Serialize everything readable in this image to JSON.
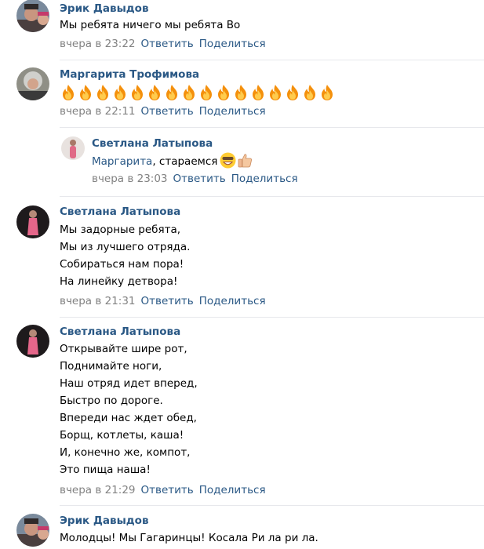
{
  "comments": [
    {
      "author": "Эрик Давыдов",
      "lines": [
        "Мы ребята ничего мы ребята Во"
      ],
      "time": "вчера в 23:22",
      "reply": "Ответить",
      "share": "Поделиться"
    },
    {
      "author": "Маргарита Трофимова",
      "emoji": "fire",
      "emoji_count": 16,
      "time": "вчера в 22:11",
      "reply": "Ответить",
      "share": "Поделиться"
    },
    {
      "author": "Светлана Латыпова",
      "mention": "Маргарита",
      "text": ", стараемся",
      "emojis": [
        "grinning-face-emoji",
        "thumbs-up-emoji"
      ],
      "time": "вчера в 23:03",
      "reply": "Ответить",
      "share": "Поделиться"
    },
    {
      "author": "Светлана Латыпова",
      "lines": [
        "Мы задорные ребята,",
        "Мы из лучшего отряда.",
        "Собираться нам пора!",
        "На линейку детвора!"
      ],
      "time": "вчера в 21:31",
      "reply": "Ответить",
      "share": "Поделиться"
    },
    {
      "author": "Светлана Латыпова",
      "lines": [
        "Открывайте шире рот,",
        "Поднимайте ноги,",
        "Наш отряд идет вперед,",
        "Быстро по дороге.",
        "Впереди нас ждет обед,",
        "Борщ, котлеты, каша!",
        "И, конечно же, компот,",
        "Это пища наша!"
      ],
      "time": "вчера в 21:29",
      "reply": "Ответить",
      "share": "Поделиться"
    },
    {
      "author": "Эрик Давыдов",
      "lines": [
        "Молодцы! Мы Гагаринцы! Косала Ри ла ри ла."
      ]
    }
  ],
  "colors": {
    "link": "#2a5885",
    "meta": "#828282",
    "divider": "#e7e8ec"
  }
}
